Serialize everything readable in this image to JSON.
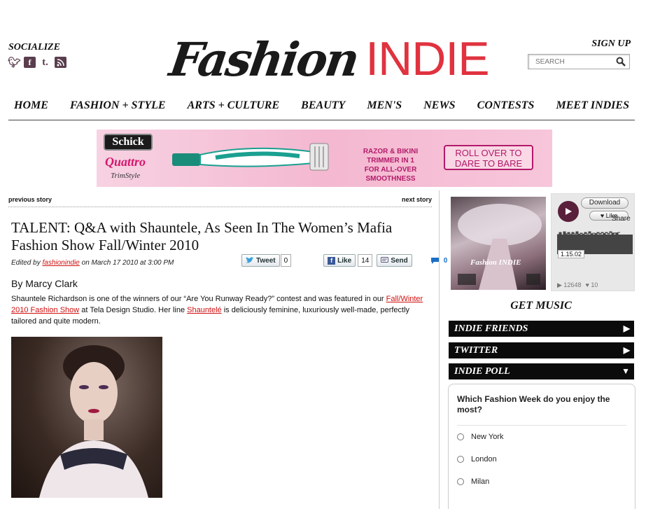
{
  "header": {
    "socialize_label": "SOCIALIZE",
    "social_icons": [
      "twitter-icon",
      "facebook-icon",
      "tumblr-icon",
      "rss-icon"
    ],
    "logo_script": "Fashion",
    "logo_indie": "INDIE",
    "signup_label": "SIGN UP",
    "search_placeholder": "SEARCH"
  },
  "nav": [
    "HOME",
    "FASHION + STYLE",
    "ARTS + CULTURE",
    "BEAUTY",
    "MEN'S",
    "NEWS",
    "CONTESTS",
    "MEET INDIES"
  ],
  "banner": {
    "brand": "Schick",
    "product": "Quattro",
    "product_sub": "TrimStyle",
    "tagline_line1": "RAZOR & BIKINI TRIMMER IN 1",
    "tagline_line2": "FOR ALL-OVER SMOOTHNESS",
    "cta_line1": "ROLL OVER TO",
    "cta_line2": "DARE TO BARE"
  },
  "story_nav": {
    "prev": "previous story",
    "next": "next story"
  },
  "article": {
    "title": "TALENT: Q&A with Shauntele, As Seen In The Women’s Mafia Fashion Show Fall/Winter 2010",
    "meta_prefix": "Edited by ",
    "meta_author": "fashionindie",
    "meta_suffix": " on March 17 2010 at 3:00 PM",
    "byline": "By Marcy Clark",
    "intro_1": "Shauntele Richardson is one of the winners of our “Are You Runway Ready?” contest and was featured in our ",
    "intro_link1": "Fall/Winter 2010 Fashion Show",
    "intro_2": " at Tela Design Studio. Her line ",
    "intro_link2": "Shauntelé",
    "intro_3": " is deliciously feminine, luxuriously well-made, perfectly tailored and quite modern."
  },
  "share": {
    "tweet_label": "Tweet",
    "tweet_count": "0",
    "like_label": "Like",
    "like_count": "14",
    "send_label": "Send",
    "comment_count": "0"
  },
  "player": {
    "download_label": "Download",
    "like_label": "Like",
    "share_label": "Share",
    "time": "1.15.02",
    "plays": "12648",
    "likes": "10",
    "art_tag": "Fashion INDIE"
  },
  "sidebar": {
    "get_music": "GET MUSIC",
    "bars": [
      {
        "label": "INDIE FRIENDS",
        "arrow": "▶"
      },
      {
        "label": "TWITTER",
        "arrow": "▶"
      },
      {
        "label": "INDIE POLL",
        "arrow": "▼"
      }
    ],
    "poll_question": "Which Fashion Week do you enjoy the most?",
    "poll_options": [
      "New York",
      "London",
      "Milan"
    ]
  }
}
